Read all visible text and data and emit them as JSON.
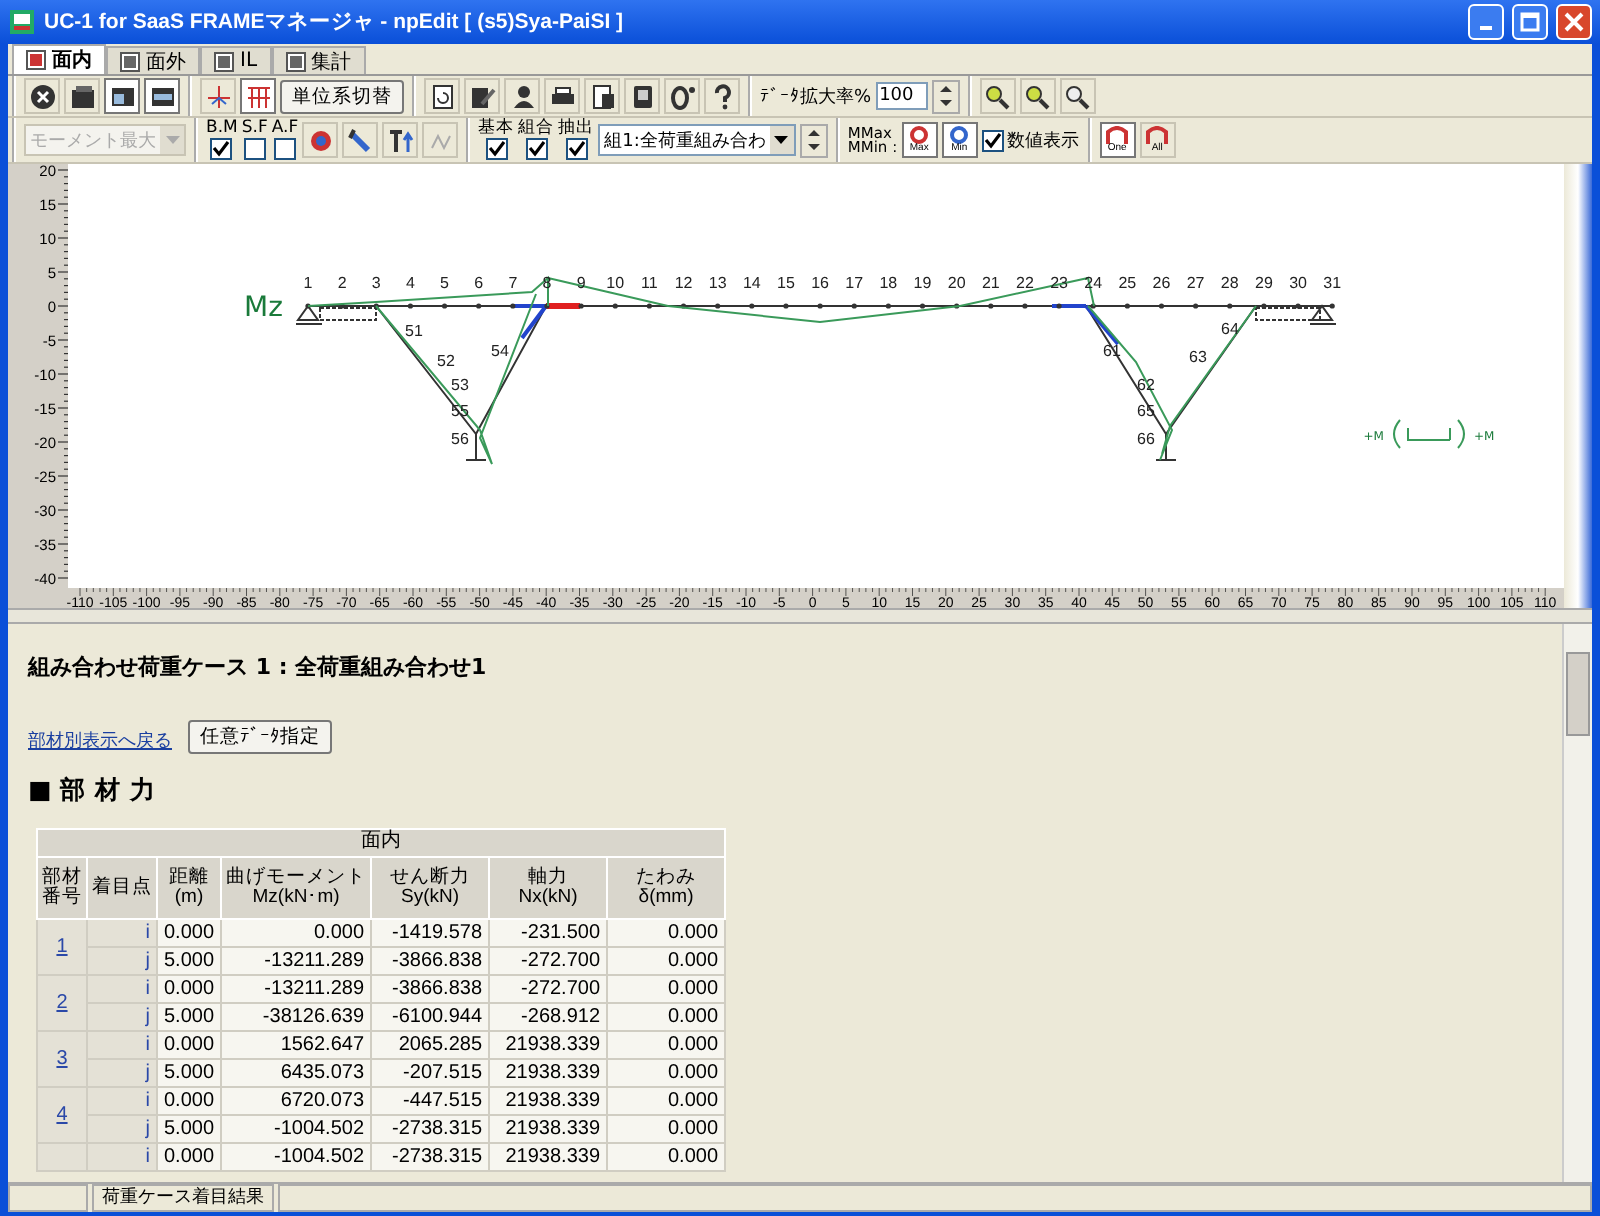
{
  "window": {
    "title": "UC-1 for SaaS FRAMEマネージャ - npEdit [ (s5)Sya-PaiSI ]"
  },
  "tabs": [
    {
      "label": "面内",
      "selected": true
    },
    {
      "label": "面外",
      "selected": false
    },
    {
      "label": "IL",
      "selected": false
    },
    {
      "label": "集計",
      "selected": false
    }
  ],
  "toolbar": {
    "unit_button": "単位系切替",
    "zoom_label": "ﾃﾞｰﾀ拡大率%",
    "zoom_value": "100"
  },
  "view_bar": {
    "moment_select": {
      "value": "モーメント最大",
      "disabled": true
    },
    "diagram_checks": [
      {
        "label": "B.M",
        "checked": true
      },
      {
        "label": "S.F",
        "checked": false
      },
      {
        "label": "A.F",
        "checked": false
      }
    ],
    "case_checks": [
      {
        "label": "基本",
        "checked": true
      },
      {
        "label": "組合",
        "checked": true
      },
      {
        "label": "抽出",
        "checked": true
      }
    ],
    "case_select": "組1:全荷重組み合わ",
    "mm_labels": [
      "MMax",
      "MMin :"
    ],
    "max_icon": "Max",
    "min_icon": "Min",
    "value_display": {
      "label": "数値表示",
      "checked": true
    },
    "one_icon": "One",
    "all_icon": "All"
  },
  "diagram": {
    "quantity_label": "Mz",
    "node_labels": [
      "1",
      "2",
      "3",
      "4",
      "5",
      "6",
      "7",
      "8",
      "9",
      "10",
      "11",
      "12",
      "13",
      "14",
      "15",
      "16",
      "17",
      "18",
      "19",
      "20",
      "21",
      "22",
      "23",
      "24",
      "25",
      "26",
      "27",
      "28",
      "29",
      "30",
      "31"
    ],
    "member_labels": [
      "51",
      "52",
      "53",
      "54",
      "55",
      "56",
      "61",
      "62",
      "63",
      "64",
      "65",
      "66"
    ],
    "legend": [
      "+M",
      "+M"
    ],
    "y_ticks": [
      "20",
      "15",
      "10",
      "5",
      "0",
      "-5",
      "-10",
      "-15",
      "-20",
      "-25",
      "-30",
      "-35",
      "-40"
    ],
    "x_ticks": [
      "-110",
      "-105",
      "-100",
      "-95",
      "-90",
      "-85",
      "-80",
      "-75",
      "-70",
      "-65",
      "-60",
      "-55",
      "-50",
      "-45",
      "-40",
      "-35",
      "-30",
      "-25",
      "-20",
      "-15",
      "-10",
      "-5",
      "0",
      "5",
      "10",
      "15",
      "20",
      "25",
      "30",
      "35",
      "40",
      "45",
      "50",
      "55",
      "60",
      "65",
      "70",
      "75",
      "80",
      "85",
      "90",
      "95",
      "100",
      "105",
      "110"
    ]
  },
  "report": {
    "heading": "組み合わせ荷重ケース 1 : 全荷重組み合わせ1",
    "back_link": "部材別表示へ戻る",
    "select_button": "任意ﾃﾞｰﾀ指定",
    "section": "■ 部 材 力",
    "table": {
      "group_header": "面内",
      "columns": [
        [
          "部材",
          "番号"
        ],
        [
          "着目点"
        ],
        [
          "距離",
          "(m)"
        ],
        [
          "曲げモーメント",
          "Mz(kN･m)"
        ],
        [
          "せん断力",
          "Sy(kN)"
        ],
        [
          "軸力",
          "Nx(kN)"
        ],
        [
          "たわみ",
          "δ(mm)"
        ]
      ],
      "groups": [
        {
          "member": "1",
          "rows": [
            [
              "i",
              "0.000",
              "0.000",
              "-1419.578",
              "-231.500",
              "0.000"
            ],
            [
              "j",
              "5.000",
              "-13211.289",
              "-3866.838",
              "-272.700",
              "0.000"
            ]
          ]
        },
        {
          "member": "2",
          "rows": [
            [
              "i",
              "0.000",
              "-13211.289",
              "-3866.838",
              "-272.700",
              "0.000"
            ],
            [
              "j",
              "5.000",
              "-38126.639",
              "-6100.944",
              "-268.912",
              "0.000"
            ]
          ]
        },
        {
          "member": "3",
          "rows": [
            [
              "i",
              "0.000",
              "1562.647",
              "2065.285",
              "21938.339",
              "0.000"
            ],
            [
              "j",
              "5.000",
              "6435.073",
              "-207.515",
              "21938.339",
              "0.000"
            ]
          ]
        },
        {
          "member": "4",
          "rows": [
            [
              "i",
              "0.000",
              "6720.073",
              "-447.515",
              "21938.339",
              "0.000"
            ],
            [
              "j",
              "5.000",
              "-1004.502",
              "-2738.315",
              "21938.339",
              "0.000"
            ]
          ]
        },
        {
          "rows": [
            [
              "i",
              "0.000",
              "-1004.502",
              "-2738.315",
              "21938.339",
              "0.000"
            ]
          ]
        }
      ]
    }
  },
  "status_bar": [
    "荷重ケース着目結果"
  ]
}
